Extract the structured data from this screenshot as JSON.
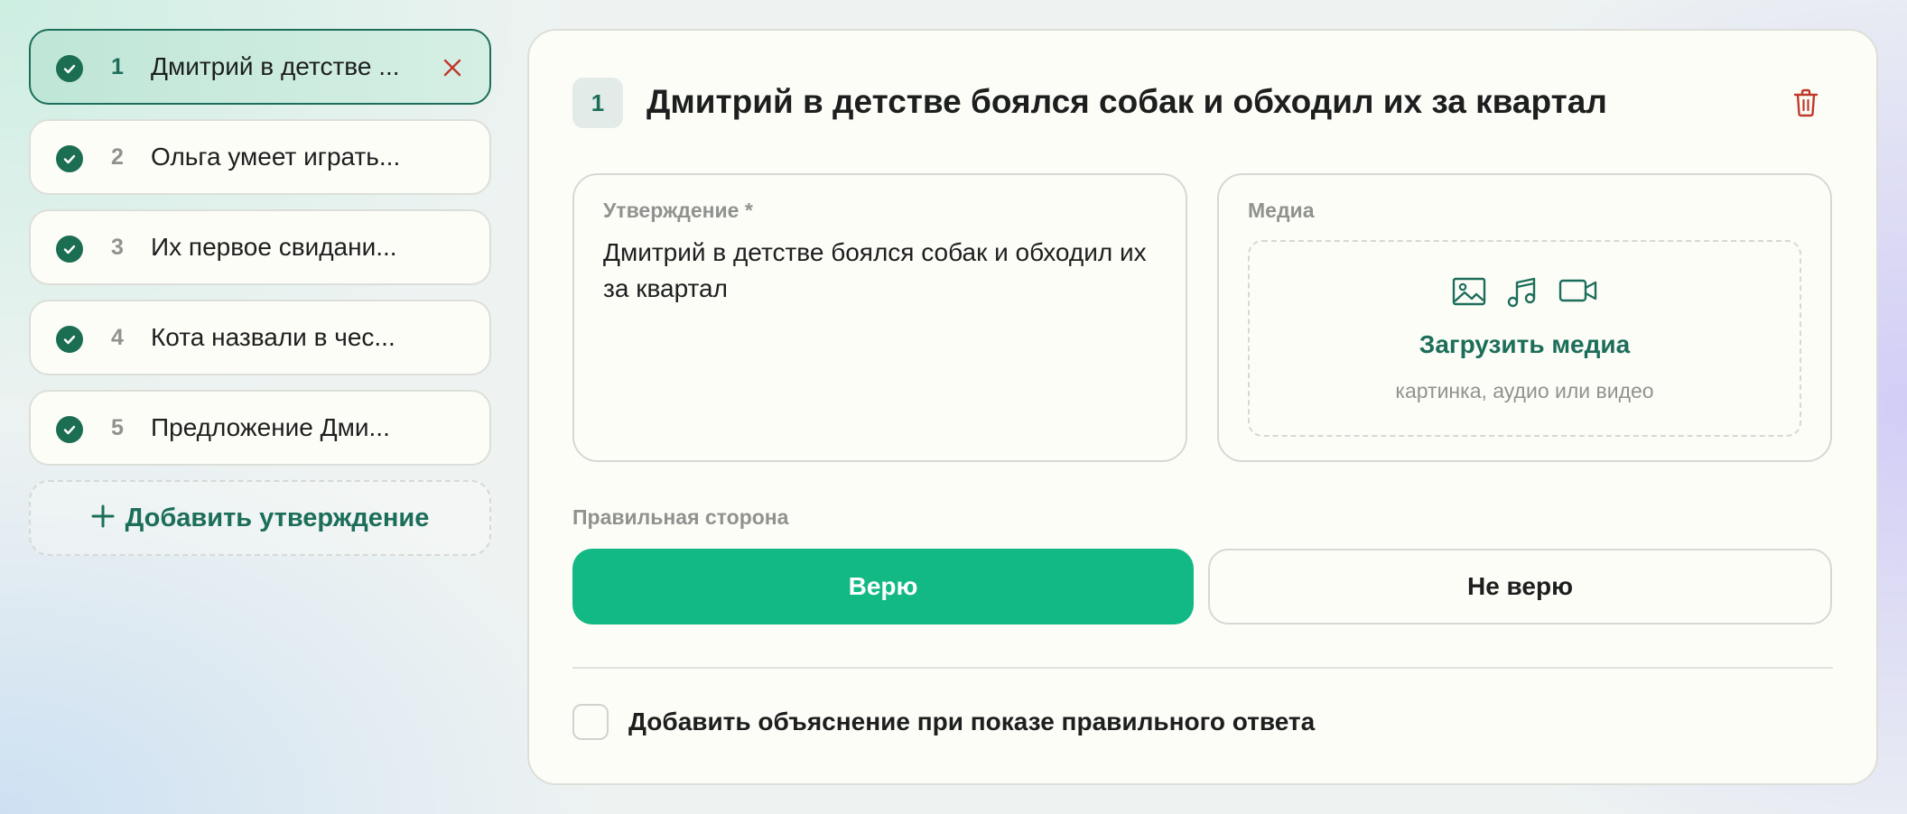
{
  "sidebar": {
    "items": [
      {
        "number": "1",
        "label": "Дмитрий в детстве ...",
        "active": true
      },
      {
        "number": "2",
        "label": "Ольга умеет играть...",
        "active": false
      },
      {
        "number": "3",
        "label": "Их первое свидани...",
        "active": false
      },
      {
        "number": "4",
        "label": "Кота назвали в чес...",
        "active": false
      },
      {
        "number": "5",
        "label": "Предложение Дми...",
        "active": false
      }
    ],
    "add_label": "Добавить утверждение"
  },
  "question": {
    "number": "1",
    "title": "Дмитрий в детстве боялся собак и обходил их за квартал"
  },
  "statement": {
    "label": "Утверждение *",
    "value": "Дмитрий в детстве боялся собак и обходил их за квартал"
  },
  "media": {
    "label": "Медиа",
    "upload_label": "Загрузить медиа",
    "hint": "картинка, аудио или видео",
    "icons": [
      "image-icon",
      "music-icon",
      "video-icon"
    ]
  },
  "correct_side": {
    "label": "Правильная сторона",
    "options": [
      "Верю",
      "Не верю"
    ],
    "selected": "Верю"
  },
  "explanation": {
    "label": "Добавить объяснение при показе правильного ответа",
    "checked": false
  },
  "colors": {
    "accent": "#1c6e5a",
    "success": "#12b984",
    "danger": "#c0392b",
    "muted": "#8f928f"
  }
}
